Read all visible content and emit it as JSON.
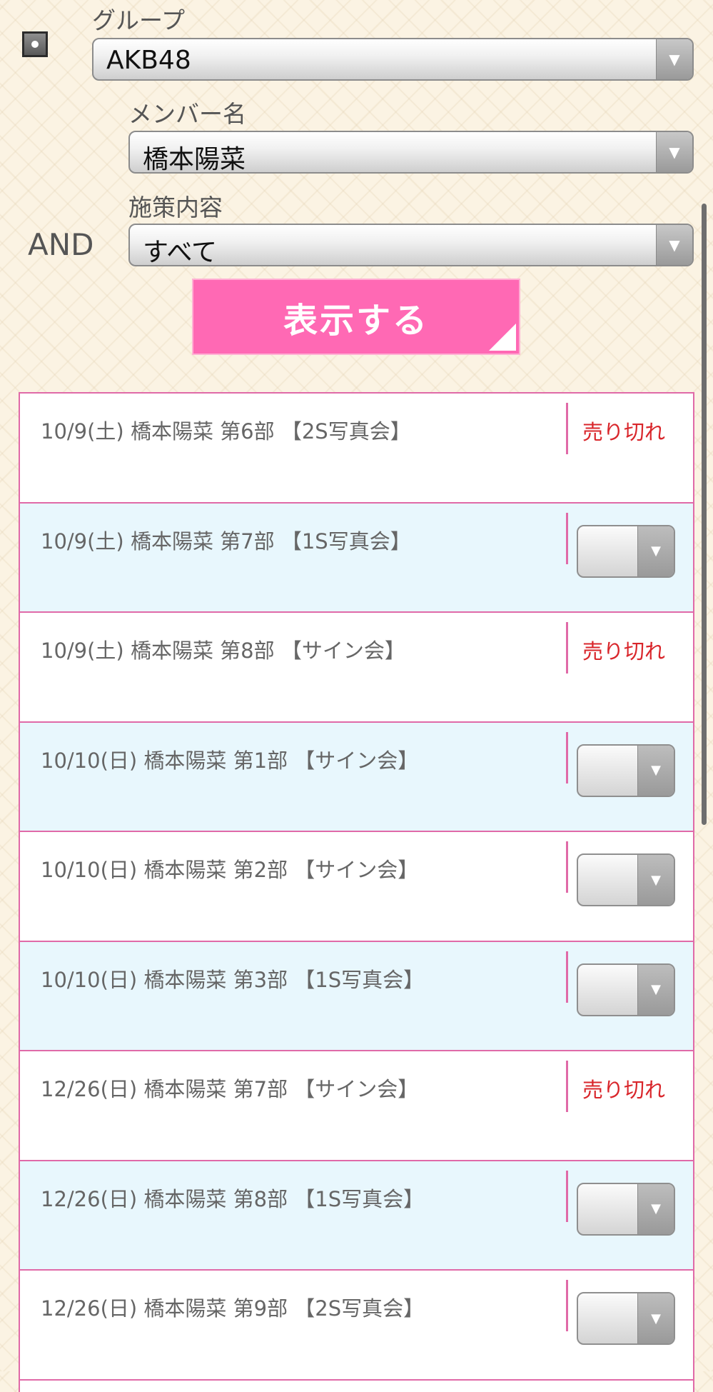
{
  "filter": {
    "group_label": "グループ",
    "group_value": "AKB48",
    "member_label": "メンバー名",
    "member_value": "橋本陽菜",
    "and_label": "AND",
    "content_label": "施策内容",
    "content_value": "すべて",
    "show_button": "表示する",
    "arrow_glyph": "▼"
  },
  "colors": {
    "accent_pink": "#ff69b4",
    "border_pink": "#e06aa8",
    "sold_out_red": "#d9262b",
    "alt_row": "#e8f7fd"
  },
  "rows": [
    {
      "text": "10/9(土) 橋本陽菜 第6部 【2S写真会】",
      "status": "売り切れ"
    },
    {
      "text": "10/9(土) 橋本陽菜 第7部 【1S写真会】",
      "status": "select"
    },
    {
      "text": "10/9(土) 橋本陽菜 第8部 【サイン会】",
      "status": "売り切れ"
    },
    {
      "text": "10/10(日) 橋本陽菜 第1部 【サイン会】",
      "status": "select"
    },
    {
      "text": "10/10(日) 橋本陽菜 第2部 【サイン会】",
      "status": "select"
    },
    {
      "text": "10/10(日) 橋本陽菜 第3部 【1S写真会】",
      "status": "select"
    },
    {
      "text": "12/26(日) 橋本陽菜 第7部 【サイン会】",
      "status": "売り切れ"
    },
    {
      "text": "12/26(日) 橋本陽菜 第8部 【1S写真会】",
      "status": "select"
    },
    {
      "text": "12/26(日) 橋本陽菜 第9部 【2S写真会】",
      "status": "select"
    }
  ]
}
